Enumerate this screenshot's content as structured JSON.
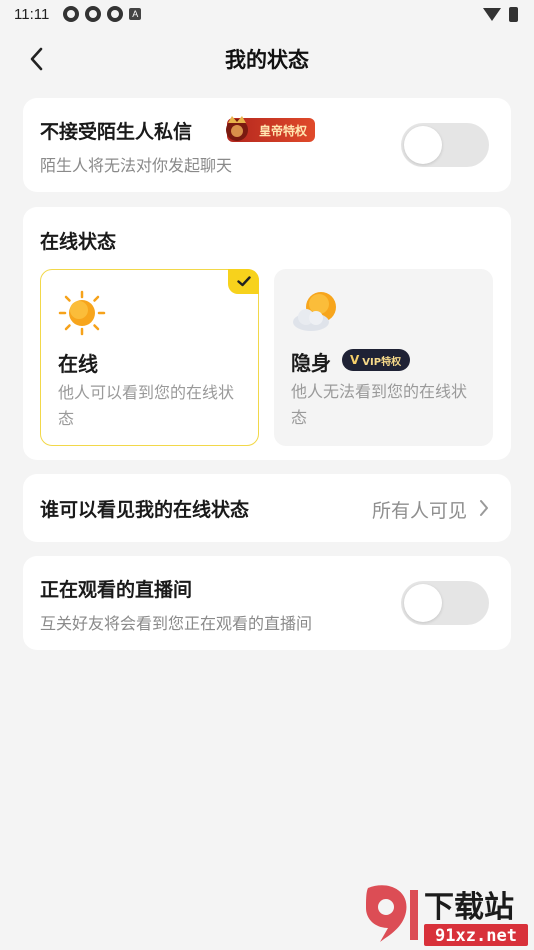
{
  "status_bar": {
    "time": "11:11",
    "badge_letter": "A"
  },
  "header": {
    "title": "我的状态"
  },
  "stranger_dm": {
    "title": "不接受陌生人私信",
    "badge": "皇帝特权",
    "subtitle": "陌生人将无法对你发起聊天",
    "enabled": false
  },
  "online_status": {
    "section_title": "在线状态",
    "options": [
      {
        "title": "在线",
        "desc": "他人可以看到您的在线状态",
        "selected": true
      },
      {
        "title": "隐身",
        "badge_v": "V",
        "badge_text": "VIP特权",
        "desc": "他人无法看到您的在线状态",
        "selected": false
      }
    ]
  },
  "visibility": {
    "title": "谁可以看见我的在线状态",
    "value": "所有人可见"
  },
  "watching_live": {
    "title": "正在观看的直播间",
    "subtitle": "互关好友将会看到您正在观看的直播间",
    "enabled": false
  },
  "watermark": {
    "text": "下载站",
    "url": "91xz.net"
  },
  "colors": {
    "accent": "#f7d21c",
    "badge_red": "#c8302a",
    "vip_dark": "#1f2235"
  }
}
